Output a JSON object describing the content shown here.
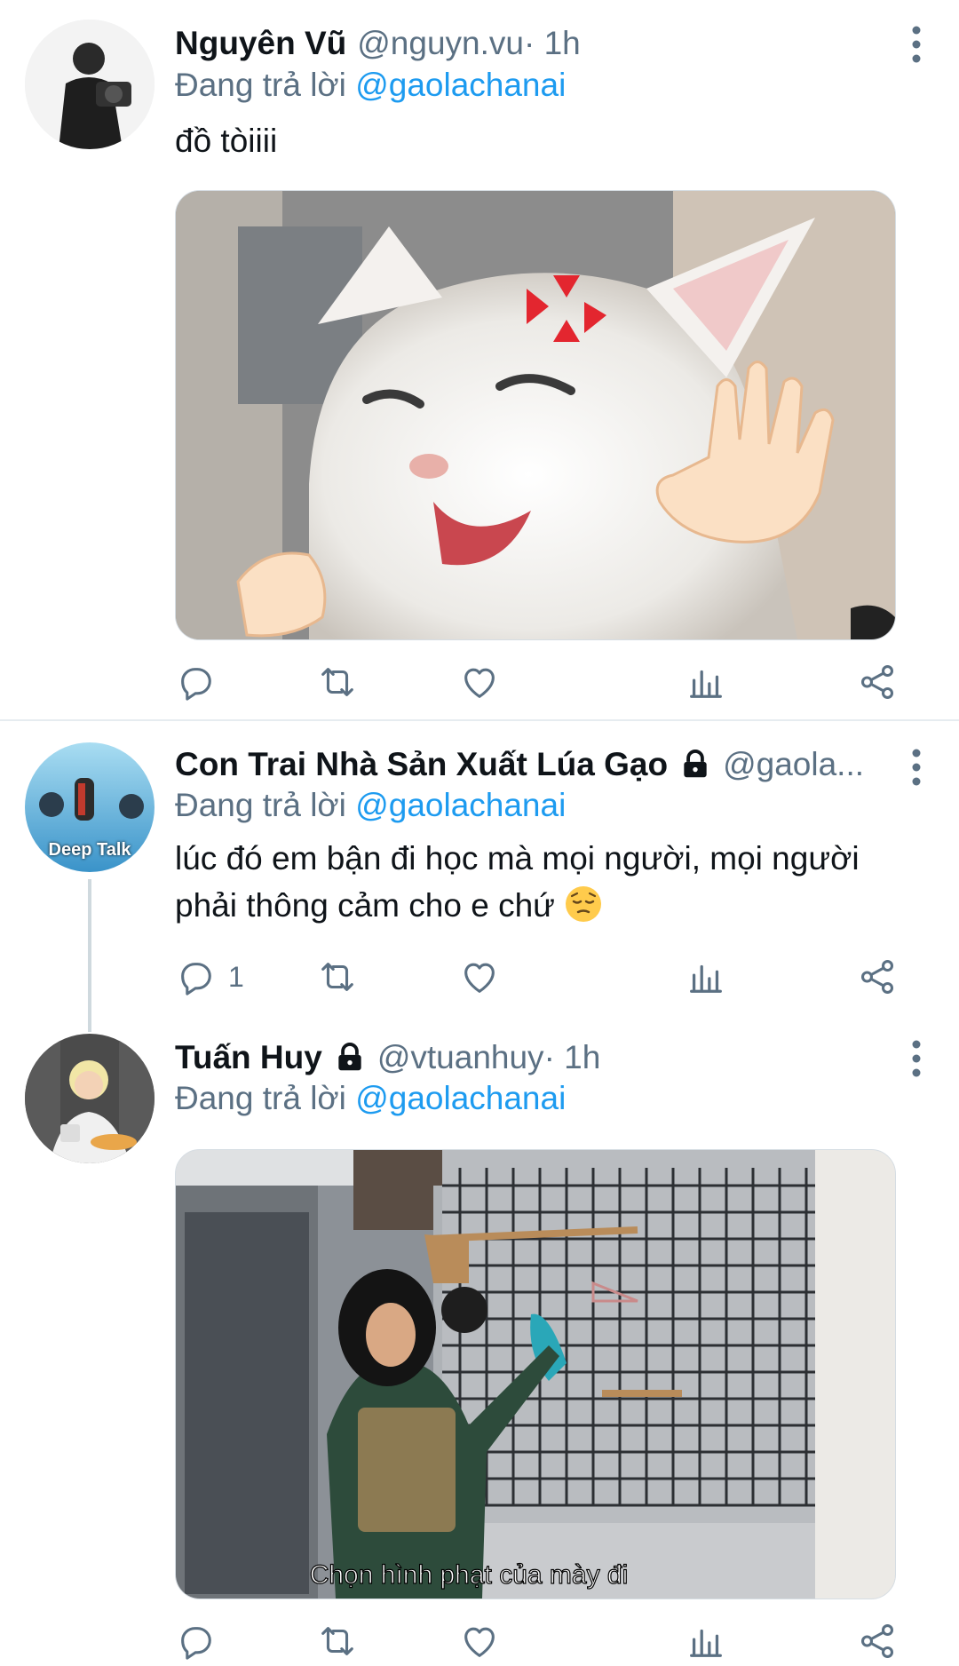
{
  "tweets": [
    {
      "name": "Nguyên Vũ",
      "handle": "@nguyn.vu",
      "time_sep": " · 1h",
      "reply_prefix": "Đang trả lời ",
      "reply_to": "@gaolachanai",
      "text": "đồ tòiiii",
      "media": "cat-angry-meme-image",
      "reply_count": ""
    },
    {
      "name": "Con Trai Nhà Sản Xuất Lúa Gạo",
      "handle": "@gaola...",
      "reply_prefix": "Đang trả lời ",
      "reply_to": "@gaolachanai",
      "text": "lúc đó em bận đi học mà mọi người, mọi người phải thông cảm cho e chứ",
      "avatar_text": "Deep Talk",
      "reply_count": "1"
    },
    {
      "name": "Tuấn Huy",
      "handle": "@vtuanhuy",
      "time_sep": " · 1h",
      "reply_prefix": "Đang trả lời ",
      "reply_to": "@gaolachanai",
      "media_caption": "Chọn hình phạt của mày đi",
      "reply_count": ""
    }
  ],
  "colors": {
    "accent": "#1d9bf0",
    "secondary_text": "#5b7083",
    "icon": "#5b7083"
  }
}
